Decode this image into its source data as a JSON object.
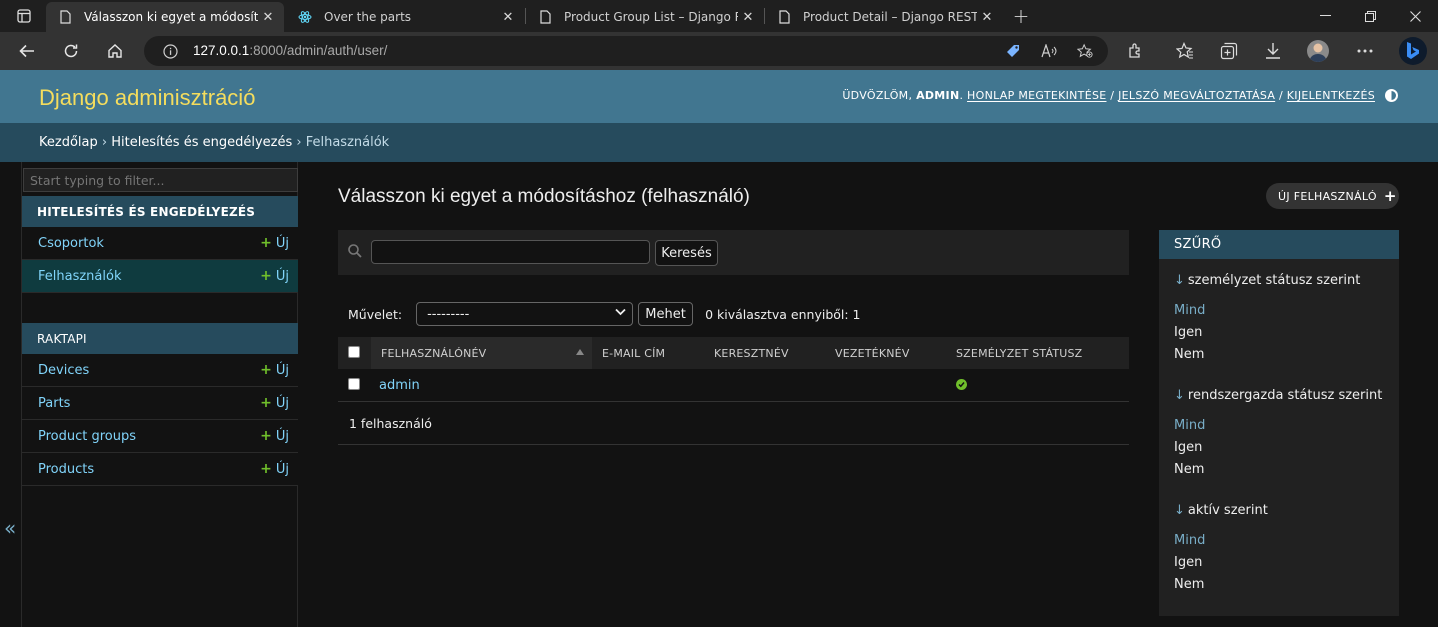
{
  "browser": {
    "tabs": [
      {
        "title": "Válasszon ki egyet a módosításho",
        "active": true
      },
      {
        "title": "Over the parts",
        "active": false
      },
      {
        "title": "Product Group List – Django REST",
        "active": false
      },
      {
        "title": "Product Detail – Django REST fran",
        "active": false
      }
    ],
    "close_glyph": "✕",
    "new_tab_glyph": "+",
    "url_host": "127.0.0.1",
    "url_rest": ":8000/admin/auth/user/"
  },
  "header": {
    "branding": "Django adminisztráció",
    "welcome": "ÜDVÖZLÖM,",
    "user": "ADMIN",
    "after_user": ".",
    "view_site": "HONLAP MEGTEKINTÉSE",
    "sep1": " / ",
    "change_password": "JELSZÓ MEGVÁLTOZTATÁSA",
    "sep2": " / ",
    "logout": "KIJELENTKEZÉS"
  },
  "breadcrumbs": {
    "home": "Kezdőlap",
    "sep": " › ",
    "app": "Hitelesítés és engedélyezés",
    "current": "Felhasználók"
  },
  "sidebar": {
    "filter_placeholder": "Start typing to filter...",
    "add_label": "Új",
    "apps": [
      {
        "caption": "HITELESÍTÉS ÉS ENGEDÉLYEZÉS",
        "models": [
          {
            "name": "Csoportok",
            "current": false
          },
          {
            "name": "Felhasználók",
            "current": true
          }
        ]
      },
      {
        "caption": "RAKTAPI",
        "models": [
          {
            "name": "Devices"
          },
          {
            "name": "Parts"
          },
          {
            "name": "Product groups"
          },
          {
            "name": "Products"
          }
        ]
      }
    ],
    "toggle_glyph": "«"
  },
  "main": {
    "title": "Válasszon ki egyet a módosításhoz (felhasználó)",
    "add_button": "ÚJ FELHASZNÁLÓ",
    "search_button": "Keresés",
    "action_label": "Művelet:",
    "action_selected": "---------",
    "go_button": "Mehet",
    "selection_counter": "0 kiválasztva ennyiből: 1",
    "columns": [
      "FELHASZNÁLÓNÉV",
      "E-MAIL CÍM",
      "KERESZTNÉV",
      "VEZETÉKNÉV",
      "SZEMÉLYZET STÁTUSZ"
    ],
    "rows": [
      {
        "username": "admin",
        "email": "",
        "first_name": "",
        "last_name": "",
        "is_staff": true
      }
    ],
    "paginator": "1 felhasználó"
  },
  "filter": {
    "caption": "SZŰRŐ",
    "arrow": "↓",
    "groups": [
      {
        "title": "személyzet státusz szerint",
        "options": [
          "Mind",
          "Igen",
          "Nem"
        ],
        "selected": 0
      },
      {
        "title": "rendszergazda státusz szerint",
        "options": [
          "Mind",
          "Igen",
          "Nem"
        ],
        "selected": 0
      },
      {
        "title": "aktív szerint",
        "options": [
          "Mind",
          "Igen",
          "Nem"
        ],
        "selected": 0
      }
    ]
  },
  "colors": {
    "header_bg": "#417690",
    "branding": "#f5dd5d",
    "breadcrumb_bg": "#264b5d",
    "link": "#81d4fa",
    "add_green": "#70bf2b"
  }
}
